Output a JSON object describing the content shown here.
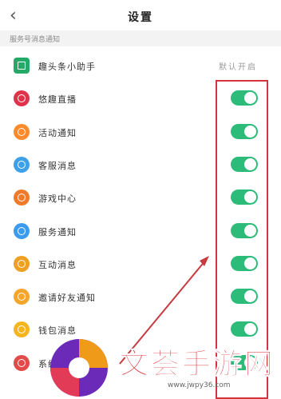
{
  "header": {
    "back_icon": "chevron-left-icon",
    "title": "设置"
  },
  "section": {
    "title": "服务号消息通知"
  },
  "rows": [
    {
      "label": "趣头条小助手",
      "icon": "square-icon",
      "color": "#25a968",
      "status": "默认开启",
      "toggle": null
    },
    {
      "label": "悠趣直播",
      "icon": "live-icon",
      "color": "#e0334b",
      "toggle": true
    },
    {
      "label": "活动通知",
      "icon": "gift-icon",
      "color": "#ff8a2b",
      "toggle": true
    },
    {
      "label": "客服消息",
      "icon": "hat-icon",
      "color": "#3ea0e8",
      "toggle": true
    },
    {
      "label": "游戏中心",
      "icon": "game-icon",
      "color": "#f07a2a",
      "toggle": true
    },
    {
      "label": "服务通知",
      "icon": "bell-icon",
      "color": "#3b9bf0",
      "toggle": true
    },
    {
      "label": "互动消息",
      "icon": "message-icon",
      "color": "#f0a020",
      "toggle": true
    },
    {
      "label": "邀请好友通知",
      "icon": "user-icon",
      "color": "#f4a52a",
      "toggle": true
    },
    {
      "label": "钱包消息",
      "icon": "coin-icon",
      "color": "#f5b51e",
      "toggle": true
    },
    {
      "label": "系统通知",
      "icon": "speaker-icon",
      "color": "#e34a4a",
      "toggle": true
    }
  ],
  "colors": {
    "toggle_on": "#2dbb7a",
    "annotation": "#d6343a"
  },
  "watermark": {
    "text": "文荟手游网",
    "url": "www.jwpy36.com"
  }
}
